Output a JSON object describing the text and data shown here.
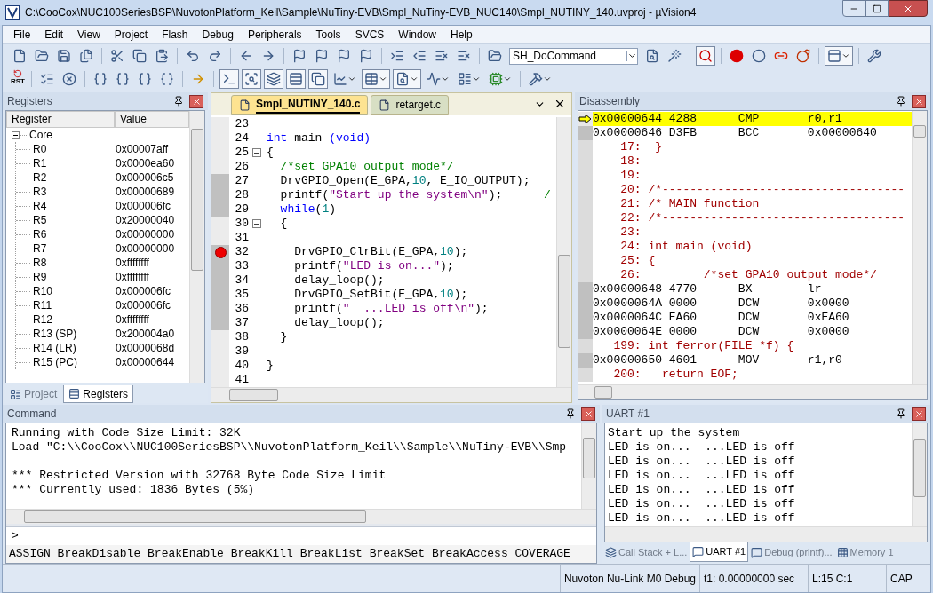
{
  "window": {
    "title": "C:\\CooCox\\NUC100SeriesBSP\\NuvotonPlatform_Keil\\Sample\\NuTiny-EVB\\Smpl_NuTiny-EVB_NUC140\\Smpl_NUTINY_140.uvproj - µVision4"
  },
  "menu": [
    "File",
    "Edit",
    "View",
    "Project",
    "Flash",
    "Debug",
    "Peripherals",
    "Tools",
    "SVCS",
    "Window",
    "Help"
  ],
  "toolbar": {
    "command_combo": "SH_DoCommand",
    "reset_label": "RST"
  },
  "registers_panel": {
    "title": "Registers",
    "columns": [
      "Register",
      "Value"
    ],
    "tree": [
      {
        "name": "Core",
        "expanded": true,
        "children": [
          {
            "name": "R0",
            "value": "0x00007aff"
          },
          {
            "name": "R1",
            "value": "0x0000ea60"
          },
          {
            "name": "R2",
            "value": "0x000006c5"
          },
          {
            "name": "R3",
            "value": "0x00000689"
          },
          {
            "name": "R4",
            "value": "0x000006fc"
          },
          {
            "name": "R5",
            "value": "0x20000040"
          },
          {
            "name": "R6",
            "value": "0x00000000"
          },
          {
            "name": "R7",
            "value": "0x00000000"
          },
          {
            "name": "R8",
            "value": "0xffffffff"
          },
          {
            "name": "R9",
            "value": "0xffffffff"
          },
          {
            "name": "R10",
            "value": "0x000006fc"
          },
          {
            "name": "R11",
            "value": "0x000006fc"
          },
          {
            "name": "R12",
            "value": "0xffffffff"
          },
          {
            "name": "R13 (SP)",
            "value": "0x200004a0"
          },
          {
            "name": "R14 (LR)",
            "value": "0x0000068d"
          },
          {
            "name": "R15 (PC)",
            "value": "0x00000644"
          }
        ]
      }
    ],
    "tabs": [
      {
        "label": "Project",
        "selected": false
      },
      {
        "label": "Registers",
        "selected": true
      }
    ]
  },
  "editor": {
    "tabs": [
      {
        "label": "Smpl_NUTINY_140.c",
        "selected": true
      },
      {
        "label": "retarget.c",
        "selected": false
      }
    ],
    "lines": [
      {
        "number": "23",
        "executed": false,
        "breakpoint": false,
        "fold": false
      },
      {
        "number": "24",
        "executed": false,
        "breakpoint": false,
        "fold": false,
        "segments": [
          {
            "kind": "keyword",
            "text": "int"
          },
          {
            "kind": "plain",
            "text": " main "
          },
          {
            "kind": "keyword",
            "text": "(void)"
          }
        ]
      },
      {
        "number": "25",
        "executed": false,
        "breakpoint": false,
        "fold": true,
        "segments": [
          {
            "kind": "plain",
            "text": "{"
          }
        ]
      },
      {
        "number": "26",
        "executed": false,
        "breakpoint": false,
        "fold": false,
        "segments": [
          {
            "kind": "comment",
            "text": "  /*set GPA10 output mode*/"
          }
        ]
      },
      {
        "number": "27",
        "executed": true,
        "breakpoint": false,
        "fold": false,
        "segments": [
          {
            "kind": "plain",
            "text": "  DrvGPIO_Open(E_GPA,"
          },
          {
            "kind": "number",
            "text": "10"
          },
          {
            "kind": "plain",
            "text": ", E_IO_OUTPUT);"
          }
        ]
      },
      {
        "number": "28",
        "executed": true,
        "breakpoint": false,
        "fold": false,
        "segments": [
          {
            "kind": "plain",
            "text": "  printf("
          },
          {
            "kind": "string",
            "text": "\"Start up the system\\n\""
          },
          {
            "kind": "plain",
            "text": ");"
          },
          {
            "kind": "comment",
            "text": "      /"
          }
        ]
      },
      {
        "number": "29",
        "executed": true,
        "breakpoint": false,
        "fold": false,
        "segments": [
          {
            "kind": "keyword",
            "text": "  while"
          },
          {
            "kind": "plain",
            "text": "("
          },
          {
            "kind": "number",
            "text": "1"
          },
          {
            "kind": "plain",
            "text": ")"
          }
        ]
      },
      {
        "number": "30",
        "executed": false,
        "breakpoint": false,
        "fold": true,
        "segments": [
          {
            "kind": "plain",
            "text": "  {"
          }
        ]
      },
      {
        "number": "31",
        "executed": false,
        "breakpoint": false,
        "fold": false
      },
      {
        "number": "32",
        "executed": true,
        "breakpoint": true,
        "fold": false,
        "segments": [
          {
            "kind": "plain",
            "text": "    DrvGPIO_ClrBit(E_GPA,"
          },
          {
            "kind": "number",
            "text": "10"
          },
          {
            "kind": "plain",
            "text": ");"
          }
        ]
      },
      {
        "number": "33",
        "executed": true,
        "breakpoint": false,
        "fold": false,
        "segments": [
          {
            "kind": "plain",
            "text": "    printf("
          },
          {
            "kind": "string",
            "text": "\"LED is on...\""
          },
          {
            "kind": "plain",
            "text": ");"
          }
        ]
      },
      {
        "number": "34",
        "executed": true,
        "breakpoint": false,
        "fold": false,
        "segments": [
          {
            "kind": "plain",
            "text": "    delay_loop();"
          }
        ]
      },
      {
        "number": "35",
        "executed": true,
        "breakpoint": false,
        "fold": false,
        "segments": [
          {
            "kind": "plain",
            "text": "    DrvGPIO_SetBit(E_GPA,"
          },
          {
            "kind": "number",
            "text": "10"
          },
          {
            "kind": "plain",
            "text": ");"
          }
        ]
      },
      {
        "number": "36",
        "executed": true,
        "breakpoint": false,
        "fold": false,
        "segments": [
          {
            "kind": "plain",
            "text": "    printf("
          },
          {
            "kind": "string",
            "text": "\"  ...LED is off\\n\""
          },
          {
            "kind": "plain",
            "text": ");"
          }
        ]
      },
      {
        "number": "37",
        "executed": true,
        "breakpoint": false,
        "fold": false,
        "segments": [
          {
            "kind": "plain",
            "text": "    delay_loop();"
          }
        ]
      },
      {
        "number": "38",
        "executed": false,
        "breakpoint": false,
        "fold": false,
        "segments": [
          {
            "kind": "plain",
            "text": "  }"
          }
        ]
      },
      {
        "number": "39",
        "executed": false,
        "breakpoint": false,
        "fold": false
      },
      {
        "number": "40",
        "executed": false,
        "breakpoint": false,
        "fold": false,
        "segments": [
          {
            "kind": "plain",
            "text": "}"
          }
        ]
      },
      {
        "number": "41",
        "executed": false,
        "breakpoint": false,
        "fold": false
      }
    ]
  },
  "disassembly": {
    "title": "Disassembly",
    "lines": [
      {
        "kind": "instruction",
        "current": true,
        "address": "0x00000644",
        "opcode": "4288",
        "mnemonic": "CMP",
        "operand": "r0,r1"
      },
      {
        "kind": "instruction",
        "current": false,
        "address": "0x00000646",
        "opcode": "D3FB",
        "mnemonic": "BCC",
        "operand": "0x00000640"
      },
      {
        "kind": "source",
        "current": false,
        "line": "17:",
        "code": "  }"
      },
      {
        "kind": "source",
        "current": false,
        "line": "18:"
      },
      {
        "kind": "source",
        "current": false,
        "line": "19:"
      },
      {
        "kind": "source",
        "current": false,
        "line": "20:",
        "code": " /*-----------------------------------"
      },
      {
        "kind": "source",
        "current": false,
        "line": "21:",
        "code": " /* MAIN function"
      },
      {
        "kind": "source",
        "current": false,
        "line": "22:",
        "code": " /*-----------------------------------"
      },
      {
        "kind": "source",
        "current": false,
        "line": "23:"
      },
      {
        "kind": "source",
        "current": false,
        "line": "24:",
        "code": " int main (void)"
      },
      {
        "kind": "source",
        "current": false,
        "line": "25:",
        "code": " {"
      },
      {
        "kind": "source",
        "current": false,
        "line": "26:",
        "code": "         /*set GPA10 output mode*/"
      },
      {
        "kind": "instruction",
        "current": false,
        "address": "0x00000648",
        "opcode": "4770",
        "mnemonic": "BX",
        "operand": "lr"
      },
      {
        "kind": "instruction",
        "current": false,
        "address": "0x0000064A",
        "opcode": "0000",
        "mnemonic": "DCW",
        "operand": "0x0000"
      },
      {
        "kind": "instruction",
        "current": false,
        "address": "0x0000064C",
        "opcode": "EA60",
        "mnemonic": "DCW",
        "operand": "0xEA60"
      },
      {
        "kind": "instruction",
        "current": false,
        "address": "0x0000064E",
        "opcode": "0000",
        "mnemonic": "DCW",
        "operand": "0x0000"
      },
      {
        "kind": "source",
        "current": false,
        "line": "199:",
        "code": " int ferror(FILE *f) {"
      },
      {
        "kind": "instruction",
        "current": false,
        "address": "0x00000650",
        "opcode": "4601",
        "mnemonic": "MOV",
        "operand": "r1,r0"
      },
      {
        "kind": "source",
        "current": false,
        "line": "200:",
        "code": "   return EOF;"
      }
    ]
  },
  "command": {
    "title": "Command",
    "output": [
      [
        "Running with Code Size Limit: 32K",
        "Load \"C:\\\\CooCox\\\\NUC100SeriesBSP\\\\NuvotonPlatform_Keil\\\\Sample\\\\NuTiny-EVB\\\\Smp"
      ],
      [
        "*** Restricted Version with 32768 Byte Code Size Limit",
        "*** Currently used: 1836 Bytes (5%)"
      ]
    ],
    "prompt": ">",
    "hints": "ASSIGN BreakDisable BreakEnable BreakKill BreakList BreakSet BreakAccess COVERAGE"
  },
  "uart": {
    "title": "UART #1",
    "lines": [
      "Start up the system",
      "LED is on...  ...LED is off",
      "LED is on...  ...LED is off",
      "LED is on...  ...LED is off",
      "LED is on...  ...LED is off",
      "LED is on...  ...LED is off",
      "LED is on...  ...LED is off"
    ],
    "tabs": [
      {
        "label": "Call Stack + L...",
        "selected": false
      },
      {
        "label": "UART #1",
        "selected": true
      },
      {
        "label": "Debug (printf)...",
        "selected": false
      },
      {
        "label": "Memory 1",
        "selected": false
      }
    ]
  },
  "status_bar": [
    "Nuvoton Nu-Link M0 Debug",
    "t1: 0.00000000 sec",
    "L:15 C:1",
    "CAP"
  ]
}
